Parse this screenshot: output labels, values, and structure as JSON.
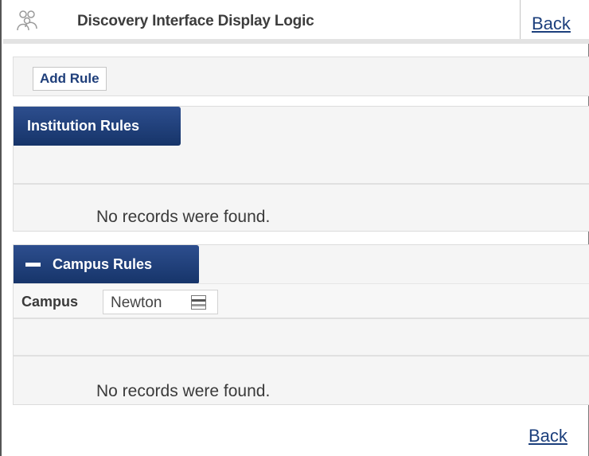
{
  "header": {
    "title": "Discovery Interface Display Logic",
    "icon": "users-icon",
    "back_label": "Back"
  },
  "toolbar": {
    "add_rule_label": "Add Rule"
  },
  "institution_rules": {
    "tab_label": "Institution Rules",
    "empty_message": "No records were found."
  },
  "campus_rules": {
    "tab_label": "Campus Rules",
    "collapse_icon": "minus-icon",
    "filter_label": "Campus",
    "filter_value": "Newton",
    "empty_message": "No records were found."
  },
  "footer": {
    "back_label": "Back"
  },
  "colors": {
    "tab_background": "#1f3f7a",
    "link": "#1c3f7c"
  }
}
